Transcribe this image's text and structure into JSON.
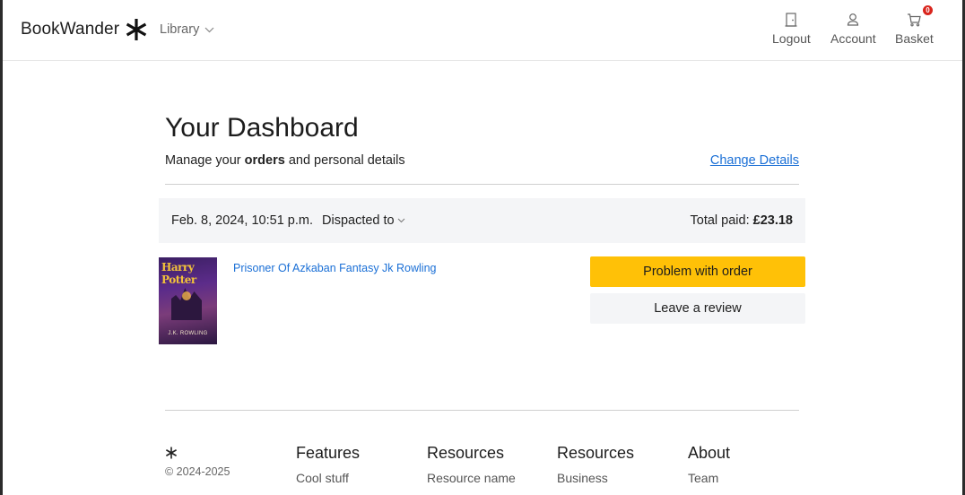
{
  "header": {
    "brand": "BookWander",
    "library_label": "Library",
    "nav": {
      "logout": "Logout",
      "account": "Account",
      "basket": "Basket",
      "basket_count": "0"
    }
  },
  "dashboard": {
    "title": "Your Dashboard",
    "subtitle_prefix": "Manage your ",
    "subtitle_bold": "orders",
    "subtitle_suffix": " and personal details",
    "change_details": "Change Details"
  },
  "order": {
    "date": "Feb. 8, 2024, 10:51 p.m.",
    "dispatch_label": "Dispacted to",
    "total_label": "Total paid: ",
    "total_value": "£23.18",
    "item_title": "Prisoner Of Azkaban Fantasy Jk Rowling",
    "cover_title": "Harry Potter",
    "cover_author": "J.K. ROWLING",
    "problem_button": "Problem with order",
    "review_button": "Leave a review"
  },
  "footer": {
    "copyright": "© 2024-2025",
    "columns": [
      {
        "heading": "Features",
        "item": "Cool stuff"
      },
      {
        "heading": "Resources",
        "item": "Resource name"
      },
      {
        "heading": "Resources",
        "item": "Business"
      },
      {
        "heading": "About",
        "item": "Team"
      }
    ]
  },
  "colors": {
    "accent_yellow": "#ffc107",
    "link_blue": "#1a6fd6",
    "badge_red": "#d9251d",
    "panel_gray": "#f4f5f7"
  }
}
